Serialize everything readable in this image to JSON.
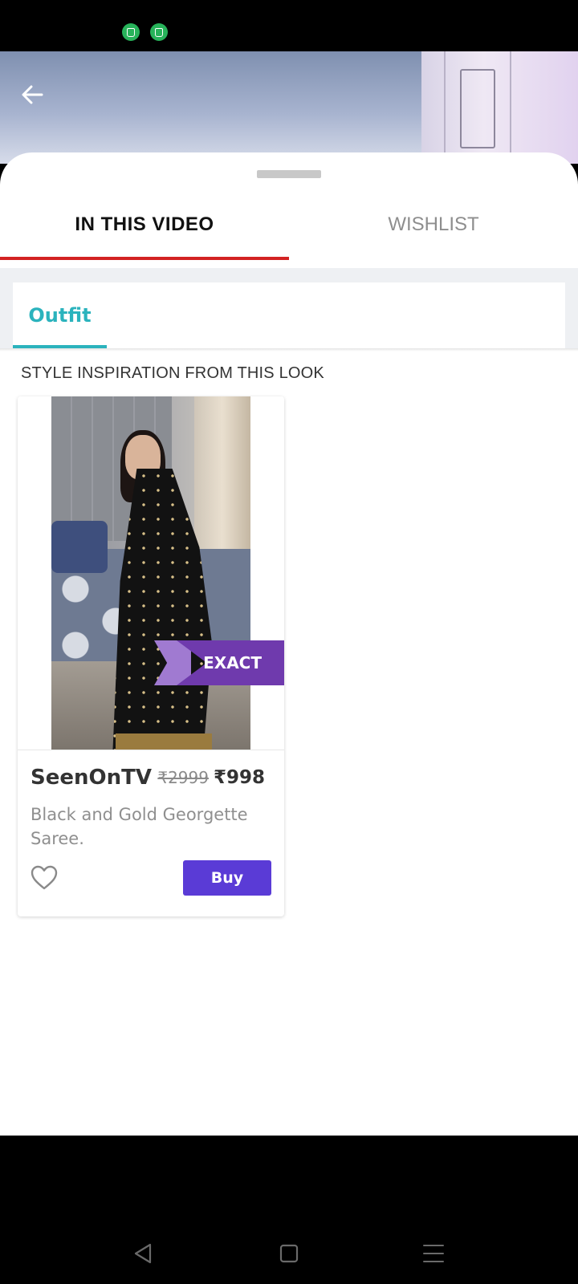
{
  "status_bar": {
    "notification_icons": [
      "shopping-bag-icon",
      "shopping-bag-icon"
    ],
    "notification_icon_color": "#27b35a"
  },
  "header": {
    "back_icon": "arrow-left-icon"
  },
  "tabs": [
    {
      "label": "IN THIS VIDEO",
      "active": true
    },
    {
      "label": "WISHLIST",
      "active": false
    }
  ],
  "sub_tabs": [
    {
      "label": "Outfit",
      "active": true
    }
  ],
  "section": {
    "heading": "STYLE INSPIRATION FROM THIS LOOK"
  },
  "product": {
    "badge": "EXACT",
    "brand": "SeenOnTV",
    "original_price": "₹2999",
    "sale_price": "₹998",
    "title": "Black and Gold Georgette Saree.",
    "buy_label": "Buy",
    "wishlist_icon": "heart-outline-icon"
  },
  "colors": {
    "tab_indicator": "#d32323",
    "sub_tab_accent": "#2bb3bd",
    "badge": "#6f3aad",
    "buy_button": "#5a3bd6"
  },
  "nav_bar": {
    "buttons": [
      "back-triangle-icon",
      "home-square-icon",
      "menu-lines-icon"
    ]
  }
}
